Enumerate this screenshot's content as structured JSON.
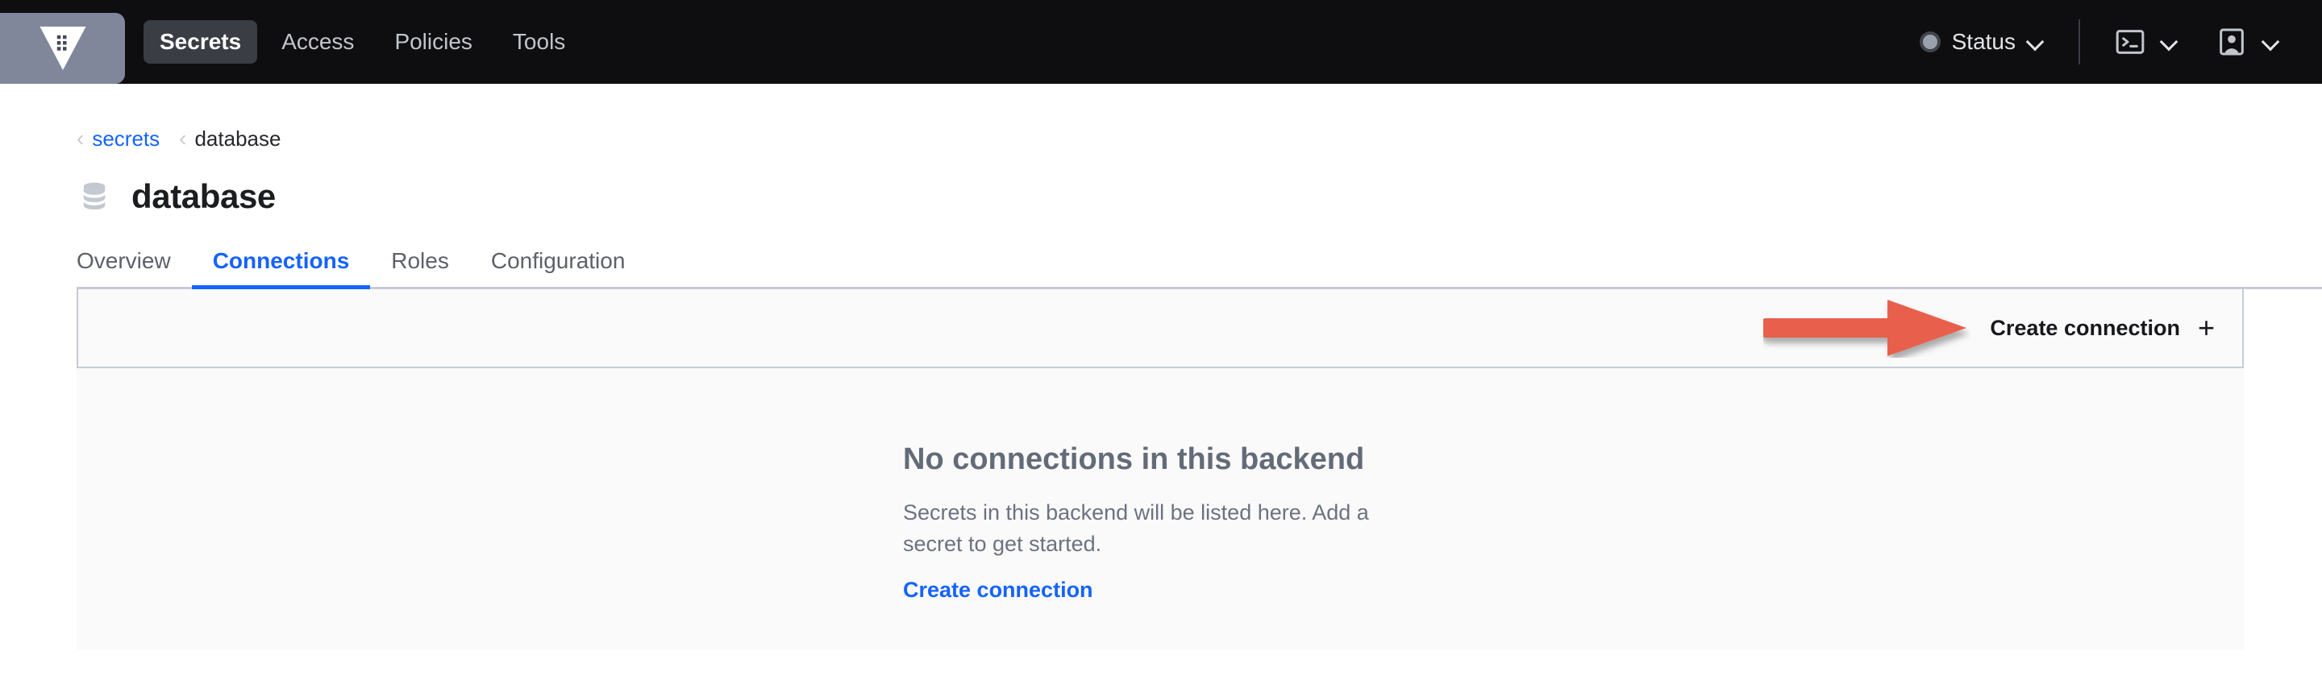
{
  "navbar": {
    "logo_icon": "vault-logo-icon",
    "links": [
      {
        "label": "Secrets",
        "active": true
      },
      {
        "label": "Access",
        "active": false
      },
      {
        "label": "Policies",
        "active": false
      },
      {
        "label": "Tools",
        "active": false
      }
    ],
    "status": {
      "label": "Status",
      "indicator_color": "#9ba1ab",
      "chevron_icon": "chevron-down-icon"
    },
    "console_icon": "terminal-icon",
    "console_chevron_icon": "chevron-down-icon",
    "user_icon": "user-icon",
    "user_chevron_icon": "chevron-down-icon"
  },
  "breadcrumb": {
    "caret": "‹",
    "items": [
      {
        "label": "secrets",
        "link": true
      },
      {
        "label": "database",
        "link": false
      }
    ]
  },
  "header": {
    "icon": "database-icon",
    "title": "database"
  },
  "tabs": [
    {
      "label": "Overview",
      "active": false
    },
    {
      "label": "Connections",
      "active": true
    },
    {
      "label": "Roles",
      "active": false
    },
    {
      "label": "Configuration",
      "active": false
    }
  ],
  "toolbar": {
    "create_label": "Create connection",
    "plus_glyph": "+",
    "annotation": {
      "shape": "arrow-right",
      "color": "#e8604c",
      "points_at": "Create connection"
    }
  },
  "empty_state": {
    "title": "No connections in this backend",
    "description": "Secrets in this backend will be listed here. Add a secret to get started.",
    "link_label": "Create connection"
  },
  "colors": {
    "accent_blue": "#1563ff",
    "nav_background": "#0e0e10",
    "logo_tile": "#80879a",
    "card_background": "#fafafa",
    "border": "#c8cbd3",
    "annotation_red": "#e8604c"
  }
}
